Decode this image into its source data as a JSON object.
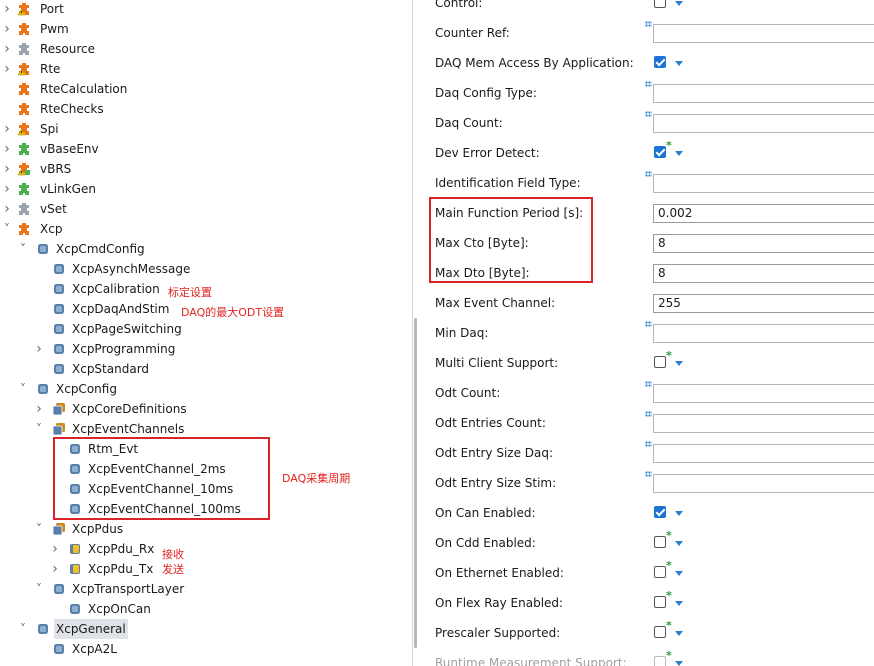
{
  "tree": {
    "items": [
      {
        "label": "Port",
        "depth": 0,
        "expander": "collapsed",
        "icon": "module-warn"
      },
      {
        "label": "Pwm",
        "depth": 0,
        "expander": "collapsed",
        "icon": "module"
      },
      {
        "label": "Resource",
        "depth": 0,
        "expander": "collapsed",
        "icon": "module-gray"
      },
      {
        "label": "Rte",
        "depth": 0,
        "expander": "collapsed",
        "icon": "module-warn"
      },
      {
        "label": "RteCalculation",
        "depth": 0,
        "expander": "none",
        "icon": "module"
      },
      {
        "label": "RteChecks",
        "depth": 0,
        "expander": "none",
        "icon": "module"
      },
      {
        "label": "Spi",
        "depth": 0,
        "expander": "collapsed",
        "icon": "module-warn"
      },
      {
        "label": "vBaseEnv",
        "depth": 0,
        "expander": "collapsed",
        "icon": "module-green"
      },
      {
        "label": "vBRS",
        "depth": 0,
        "expander": "collapsed",
        "icon": "module-warn-green"
      },
      {
        "label": "vLinkGen",
        "depth": 0,
        "expander": "collapsed",
        "icon": "module-green"
      },
      {
        "label": "vSet",
        "depth": 0,
        "expander": "collapsed",
        "icon": "module-gray"
      },
      {
        "label": "Xcp",
        "depth": 0,
        "expander": "expanded",
        "icon": "module"
      },
      {
        "label": "XcpCmdConfig",
        "depth": 1,
        "expander": "expanded",
        "icon": "container"
      },
      {
        "label": "XcpAsynchMessage",
        "depth": 2,
        "expander": "none",
        "icon": "container"
      },
      {
        "label": "XcpCalibration",
        "depth": 2,
        "expander": "none",
        "icon": "container"
      },
      {
        "label": "XcpDaqAndStim",
        "depth": 2,
        "expander": "none",
        "icon": "container"
      },
      {
        "label": "XcpPageSwitching",
        "depth": 2,
        "expander": "none",
        "icon": "container"
      },
      {
        "label": "XcpProgramming",
        "depth": 2,
        "expander": "collapsed",
        "icon": "container"
      },
      {
        "label": "XcpStandard",
        "depth": 2,
        "expander": "none",
        "icon": "container"
      },
      {
        "label": "XcpConfig",
        "depth": 1,
        "expander": "expanded",
        "icon": "container"
      },
      {
        "label": "XcpCoreDefinitions",
        "depth": 2,
        "expander": "collapsed",
        "icon": "container-stack"
      },
      {
        "label": "XcpEventChannels",
        "depth": 2,
        "expander": "expanded",
        "icon": "container-stack"
      },
      {
        "label": "Rtm_Evt",
        "depth": 3,
        "expander": "none",
        "icon": "container"
      },
      {
        "label": "XcpEventChannel_2ms",
        "depth": 3,
        "expander": "none",
        "icon": "container"
      },
      {
        "label": "XcpEventChannel_10ms",
        "depth": 3,
        "expander": "none",
        "icon": "container"
      },
      {
        "label": "XcpEventChannel_100ms",
        "depth": 3,
        "expander": "none",
        "icon": "container"
      },
      {
        "label": "XcpPdus",
        "depth": 2,
        "expander": "expanded",
        "icon": "container-stack"
      },
      {
        "label": "XcpPdu_Rx",
        "depth": 3,
        "expander": "collapsed",
        "icon": "container-yellow"
      },
      {
        "label": "XcpPdu_Tx",
        "depth": 3,
        "expander": "collapsed",
        "icon": "container-yellow"
      },
      {
        "label": "XcpTransportLayer",
        "depth": 2,
        "expander": "expanded",
        "icon": "container"
      },
      {
        "label": "XcpOnCan",
        "depth": 3,
        "expander": "none",
        "icon": "container"
      },
      {
        "label": "XcpGeneral",
        "depth": 1,
        "expander": "expanded",
        "icon": "container",
        "selected": true
      },
      {
        "label": "XcpA2L",
        "depth": 2,
        "expander": "none",
        "icon": "container"
      }
    ]
  },
  "annotations": {
    "calibration": "标定设置",
    "daq_odt": "DAQ的最大ODT设置",
    "daq_period": "DAQ采集周期",
    "rx": "接收",
    "tx": "发送"
  },
  "properties": [
    {
      "label": "Control:",
      "kind": "check",
      "checked": false,
      "star": false
    },
    {
      "label": "Counter Ref:",
      "kind": "field",
      "value": ""
    },
    {
      "label": "DAQ Mem Access By Application:",
      "kind": "check",
      "checked": true,
      "star": false
    },
    {
      "label": "Daq Config Type:",
      "kind": "field",
      "value": ""
    },
    {
      "label": "Daq Count:",
      "kind": "field",
      "value": ""
    },
    {
      "label": "Dev Error Detect:",
      "kind": "check",
      "checked": true,
      "star": true
    },
    {
      "label": "Identification Field Type:",
      "kind": "field",
      "value": ""
    },
    {
      "label": "Main Function Period [s]:",
      "kind": "field",
      "value": "0.002",
      "mark": false
    },
    {
      "label": "Max Cto [Byte]:",
      "kind": "field",
      "value": "8",
      "mark": false
    },
    {
      "label": "Max Dto [Byte]:",
      "kind": "field",
      "value": "8",
      "mark": false
    },
    {
      "label": "Max Event Channel:",
      "kind": "field",
      "value": "255",
      "mark": false
    },
    {
      "label": "Min Daq:",
      "kind": "field",
      "value": ""
    },
    {
      "label": "Multi Client Support:",
      "kind": "check",
      "checked": false,
      "star": true
    },
    {
      "label": "Odt Count:",
      "kind": "field",
      "value": ""
    },
    {
      "label": "Odt Entries Count:",
      "kind": "field",
      "value": ""
    },
    {
      "label": "Odt Entry Size Daq:",
      "kind": "field",
      "value": ""
    },
    {
      "label": "Odt Entry Size Stim:",
      "kind": "field",
      "value": ""
    },
    {
      "label": "On Can Enabled:",
      "kind": "check",
      "checked": true,
      "star": false
    },
    {
      "label": "On Cdd Enabled:",
      "kind": "check",
      "checked": false,
      "star": true
    },
    {
      "label": "On Ethernet Enabled:",
      "kind": "check",
      "checked": false,
      "star": true
    },
    {
      "label": "On Flex Ray Enabled:",
      "kind": "check",
      "checked": false,
      "star": true
    },
    {
      "label": "Prescaler Supported:",
      "kind": "check",
      "checked": false,
      "star": true
    },
    {
      "label": "Runtime Measurement Support:",
      "kind": "check",
      "checked": false,
      "star": true,
      "faded": true
    }
  ],
  "colors": {
    "annotation_red": "#d9252a",
    "checkbox_blue": "#1e73d6",
    "module_orange": "#e8751a",
    "container_blue": "#5a7fa8"
  }
}
